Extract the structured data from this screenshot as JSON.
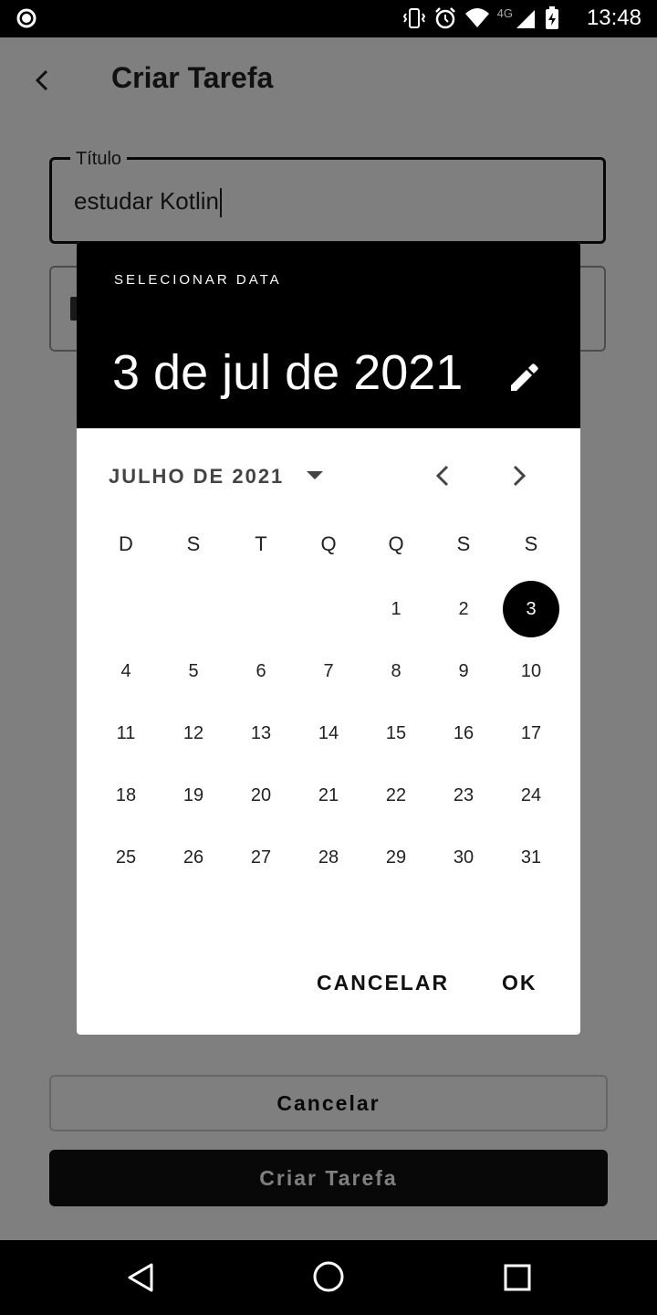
{
  "status_bar": {
    "time": "13:48",
    "network": "4G",
    "icons": [
      "vibrate-icon",
      "alarm-icon",
      "wifi-icon",
      "signal-icon",
      "battery-charging-icon"
    ]
  },
  "app": {
    "title": "Criar Tarefa",
    "title_field": {
      "label": "Título",
      "value": "estudar Kotlin"
    },
    "cancel_button": "Cancelar",
    "create_button": "Criar Tarefa"
  },
  "date_picker": {
    "caption": "SELECIONAR DATA",
    "selected_date_text": "3 de jul de 2021",
    "month_label": "JULHO DE 2021",
    "weekdays": [
      "D",
      "S",
      "T",
      "Q",
      "Q",
      "S",
      "S"
    ],
    "weeks": [
      [
        "",
        "",
        "",
        "",
        "1",
        "2",
        "3"
      ],
      [
        "4",
        "5",
        "6",
        "7",
        "8",
        "9",
        "10"
      ],
      [
        "11",
        "12",
        "13",
        "14",
        "15",
        "16",
        "17"
      ],
      [
        "18",
        "19",
        "20",
        "21",
        "22",
        "23",
        "24"
      ],
      [
        "25",
        "26",
        "27",
        "28",
        "29",
        "30",
        "31"
      ]
    ],
    "selected_day": "3",
    "cancel_label": "CANCELAR",
    "ok_label": "OK"
  },
  "colors": {
    "primary": "#000000",
    "scrim": "rgba(0,0,0,0.5)",
    "surface": "#ffffff"
  }
}
